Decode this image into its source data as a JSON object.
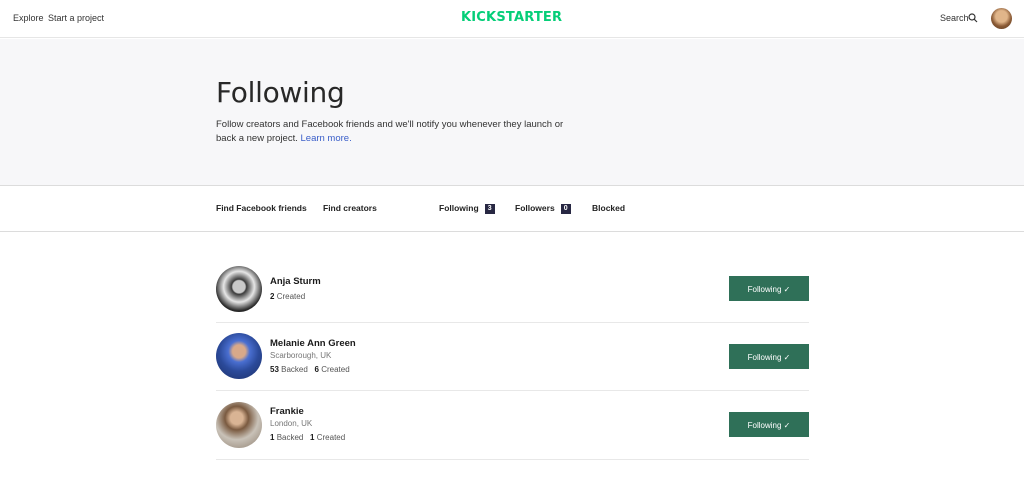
{
  "header": {
    "explore": "Explore",
    "start_project": "Start a project",
    "logo": "KICKSTARTER",
    "search": "Search"
  },
  "hero": {
    "title": "Following",
    "description": "Follow creators and Facebook friends and we'll notify you whenever they launch or back a new project.",
    "learn_more": "Learn more."
  },
  "tabs": [
    {
      "label": "Find Facebook friends"
    },
    {
      "label": "Find creators"
    },
    {
      "label": "Following",
      "count": "3"
    },
    {
      "label": "Followers",
      "count": "0"
    },
    {
      "label": "Blocked"
    }
  ],
  "people": [
    {
      "name": "Anja Sturm",
      "location": "",
      "created": "2",
      "created_label": "Created",
      "button": "Following ✓"
    },
    {
      "name": "Melanie Ann Green",
      "location": "Scarborough, UK",
      "backed": "53",
      "backed_label": "Backed",
      "created": "6",
      "created_label": "Created",
      "button": "Following ✓"
    },
    {
      "name": "Frankie",
      "location": "London, UK",
      "backed": "1",
      "backed_label": "Backed",
      "created": "1",
      "created_label": "Created",
      "button": "Following ✓"
    }
  ],
  "colors": {
    "brand": "#05ce78",
    "button": "#2f7058",
    "badge": "#282843",
    "link": "#3a5ec9"
  }
}
